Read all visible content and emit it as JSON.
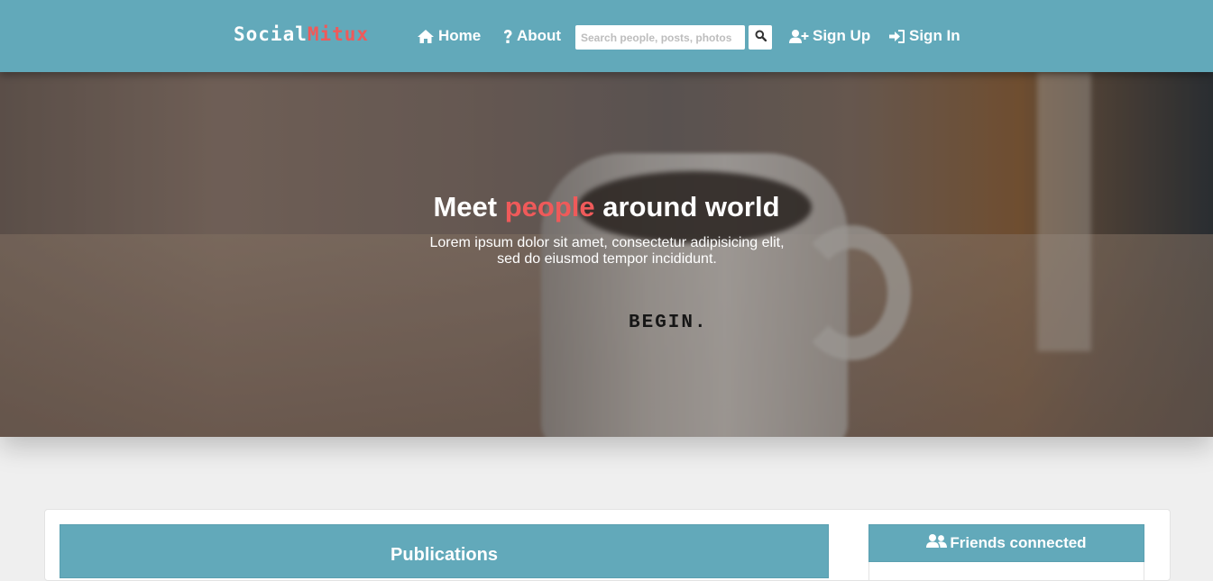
{
  "header": {
    "logo": {
      "part1": "Social",
      "part2": "Mitux"
    },
    "nav": {
      "home": "Home",
      "about": "About",
      "signup": "Sign Up",
      "signin": "Sign In"
    },
    "search": {
      "placeholder": "Search people, posts, photos",
      "value": ""
    },
    "icons": {
      "home": "home-icon",
      "about": "question-icon",
      "search": "search-icon",
      "signup": "user-plus-icon",
      "signin": "sign-in-icon"
    }
  },
  "hero": {
    "title_part1": "Meet ",
    "title_accent": "people",
    "title_part2": " around world",
    "text_line1": "Lorem ipsum dolor sit amet, consectetur adipisicing elit,",
    "text_line2": "sed do eiusmod tempor incididunt.",
    "mug_print": "BEGIN."
  },
  "main": {
    "publications_title": "Publications",
    "friends_title": "Friends connected",
    "friends_icon": "users-icon"
  },
  "colors": {
    "primary": "#62a9ba",
    "accent": "#ef5a5a",
    "background": "#efefef",
    "text_light": "#ffffff"
  }
}
